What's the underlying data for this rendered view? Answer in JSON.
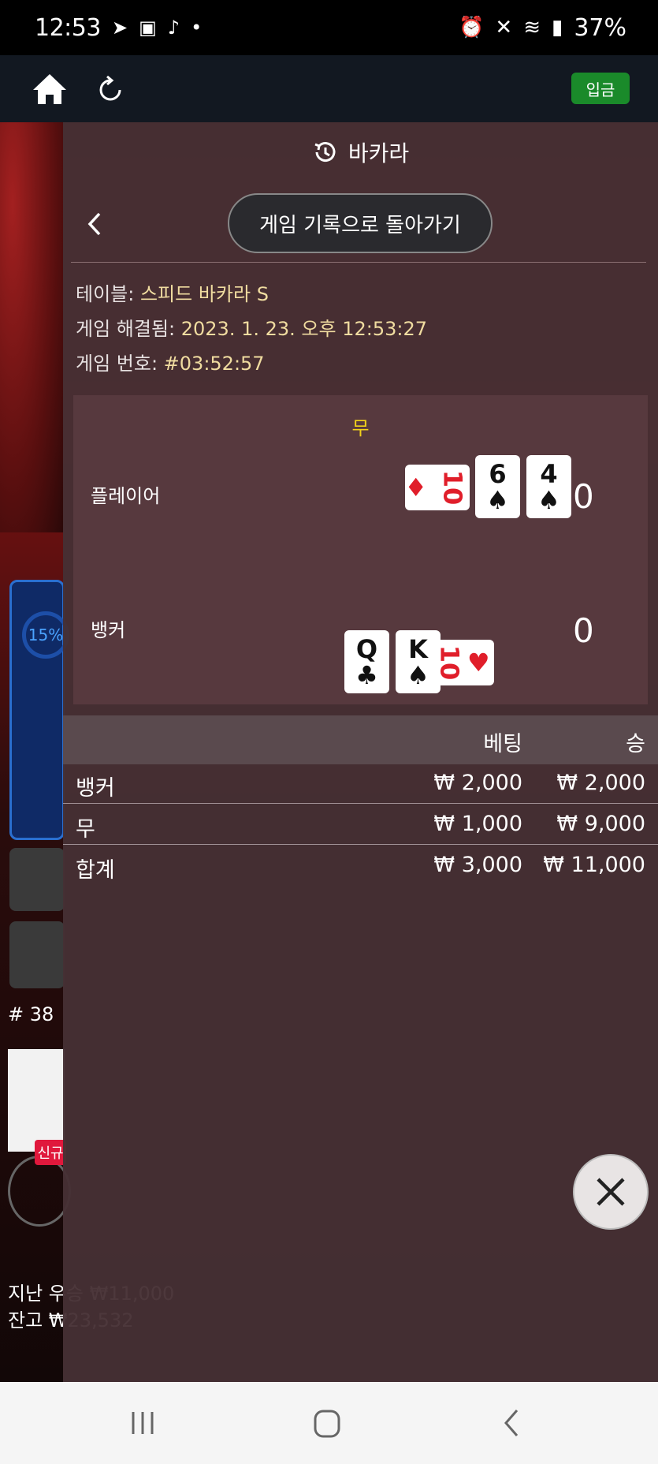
{
  "status_bar": {
    "time": "12:53",
    "battery": "37%"
  },
  "app_header": {
    "deposit_label": "입금"
  },
  "background": {
    "progress_percent": "15%",
    "round": "# 38",
    "new_badge": "신규",
    "last_win": "지난 우승 ₩11,000",
    "balance": "잔고 ₩23,532"
  },
  "modal": {
    "title": "바카라",
    "back_button_label": "게임 기록으로 돌아가기",
    "table_label": "테이블: ",
    "table_value": "스피드 바카라 S",
    "resolved_label": "게임 해결됨: ",
    "resolved_value": "2023. 1. 23. 오후 12:53:27",
    "game_no_label": "게임 번호: ",
    "game_no_value": "#03:52:57",
    "result": "무",
    "player": {
      "label": "플레이어",
      "score": "0",
      "cards": [
        {
          "rank": "10",
          "suit": "♦",
          "color": "#e01e2a"
        },
        {
          "rank": "6",
          "suit": "♠",
          "color": "#111111"
        },
        {
          "rank": "4",
          "suit": "♠",
          "color": "#111111"
        }
      ]
    },
    "banker": {
      "label": "뱅커",
      "score": "0",
      "cards": [
        {
          "rank": "Q",
          "suit": "♣",
          "color": "#111111"
        },
        {
          "rank": "K",
          "suit": "♠",
          "color": "#111111"
        },
        {
          "rank": "10",
          "suit": "♥",
          "color": "#e01e2a"
        }
      ]
    },
    "bets": {
      "col_bet": "베팅",
      "col_win": "승",
      "rows": [
        {
          "name": "뱅커",
          "bet": "₩ 2,000",
          "win": "₩ 2,000"
        },
        {
          "name": "무",
          "bet": "₩ 1,000",
          "win": "₩ 9,000"
        }
      ],
      "total": {
        "name": "합계",
        "bet": "₩ 3,000",
        "win": "₩ 11,000"
      }
    }
  }
}
